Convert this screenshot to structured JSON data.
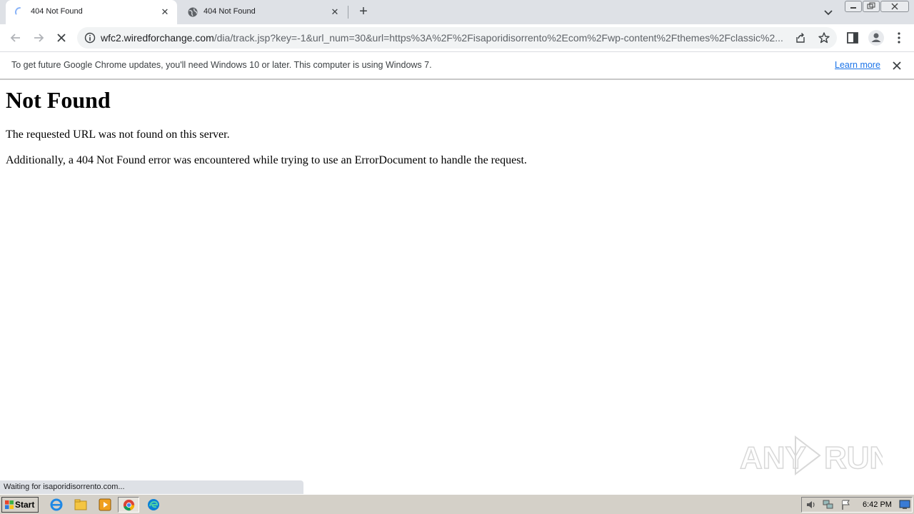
{
  "tabs": [
    {
      "title": "404 Not Found",
      "active": true
    },
    {
      "title": "404 Not Found",
      "active": false
    }
  ],
  "omnibox": {
    "host": "wfc2.wiredforchange.com",
    "path": "/dia/track.jsp?key=-1&url_num=30&url=https%3A%2F%2Fisaporidisorrento%2Ecom%2Fwp-content%2Fthemes%2Fclassic%2..."
  },
  "infobar": {
    "message": "To get future Google Chrome updates, you'll need Windows 10 or later. This computer is using Windows 7.",
    "learn_more": "Learn more"
  },
  "page": {
    "heading": "Not Found",
    "line1": "The requested URL was not found on this server.",
    "line2": "Additionally, a 404 Not Found error was encountered while trying to use an ErrorDocument to handle the request."
  },
  "status": "Waiting for isaporidisorrento.com...",
  "taskbar": {
    "start": "Start",
    "clock": "6:42 PM"
  },
  "watermark": "ANY RUN",
  "colors": {
    "tabstrip": "#dee1e6",
    "omnibox": "#f1f3f4",
    "link": "#1a73e8",
    "taskbar": "#d4d0c8"
  }
}
